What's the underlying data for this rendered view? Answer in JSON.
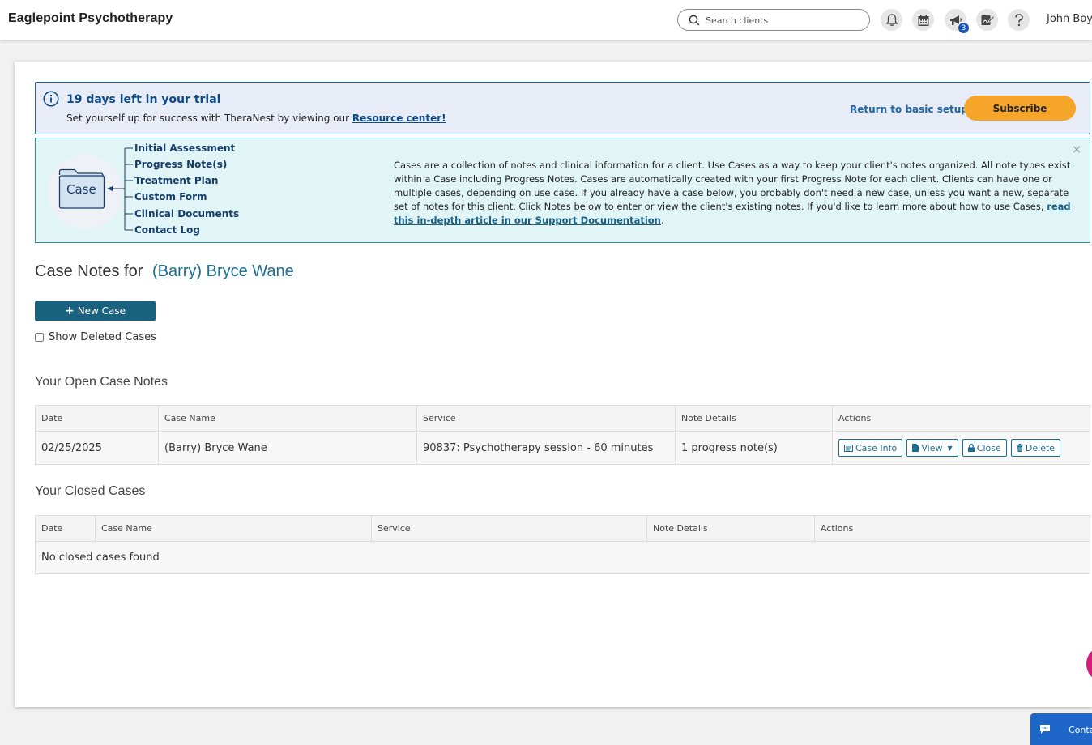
{
  "header": {
    "brand": "Eaglepoint Psychotherapy",
    "search_placeholder": "Search clients",
    "icons": [
      "bell-icon",
      "calendar-icon",
      "megaphone-icon",
      "signature-icon",
      "help-icon"
    ],
    "announcements_badge": "3",
    "user_name": "John Boy"
  },
  "trial": {
    "title": "19 days left in your trial",
    "message": "Set yourself up for success with TheraNest by viewing our",
    "resource_link": "Resource center!",
    "return_link": "Return to basic setup",
    "subscribe_label": "Subscribe"
  },
  "case_info": {
    "folder_label": "Case",
    "items": [
      "Initial Assessment",
      "Progress Note(s)",
      "Treatment Plan",
      "Custom Form",
      "Clinical Documents",
      "Contact Log"
    ],
    "description": "Cases are a collection of notes and clinical information for a client. Use Cases as a way to keep your client's notes organized. All note types exist within a Case including Progress Notes. Cases are automatically created with your first Progress Note for each client. Clients can have one or multiple cases, depending on use case. If you already have a case below, you probably don't need a new case, unless you want a new, separate set of notes for this client. Click Notes below to enter or view the client's existing notes. If you'd like to learn more about how to use Cases,",
    "doc_link": "read this in-depth article in our Support Documentation",
    "close_symbol": "×"
  },
  "page": {
    "title_prefix": "Case Notes for",
    "client_name": "(Barry) Bryce Wane",
    "new_case_label": "New Case",
    "show_deleted_label": "Show Deleted Cases"
  },
  "open_cases": {
    "title": "Your Open Case Notes",
    "columns": [
      "Date",
      "Case Name",
      "Service",
      "Note Details",
      "Actions"
    ],
    "rows": [
      {
        "date": "02/25/2025",
        "case_name": "(Barry) Bryce Wane",
        "service": "90837: Psychotherapy session - 60 minutes",
        "note_details": "1 progress note(s)"
      }
    ],
    "actions": {
      "case_info": "Case Info",
      "view": "View",
      "close": "Close",
      "delete": "Delete"
    }
  },
  "closed_cases": {
    "title": "Your Closed Cases",
    "columns": [
      "Date",
      "Case Name",
      "Service",
      "Note Details",
      "Actions"
    ],
    "empty_message": "No closed cases found"
  },
  "contact_widget": {
    "label": "Contact us"
  },
  "colors": {
    "brand_teal": "#18617f",
    "trial_blue": "#0b4a8b",
    "subscribe_orange": "#f4a52a",
    "info_bg": "#e1f5f7"
  }
}
